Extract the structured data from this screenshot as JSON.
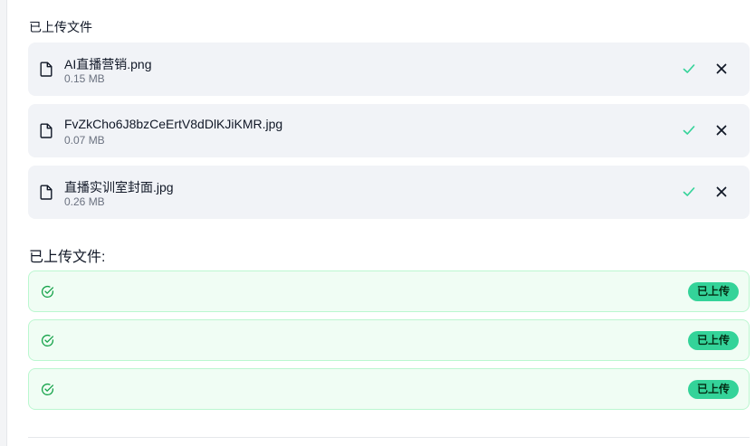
{
  "upload_section": {
    "heading": "已上传文件",
    "files": [
      {
        "name": "AI直播营销.png",
        "size": "0.15 MB"
      },
      {
        "name": "FvZkCho6J8bzCeErtV8dDlKJiKMR.jpg",
        "size": "0.07 MB"
      },
      {
        "name": "直播实训室封面.jpg",
        "size": "0.26 MB"
      }
    ]
  },
  "uploaded_section": {
    "heading": "已上传文件:",
    "rows": [
      {
        "badge": "已上传"
      },
      {
        "badge": "已上传"
      },
      {
        "badge": "已上传"
      }
    ]
  },
  "colors": {
    "card_bg": "#f1f3f7",
    "success_green": "#34d399",
    "success_row_bg": "#f0fdf4",
    "success_border": "#bbf7d0",
    "check_color": "#34d399"
  },
  "icons": {
    "file": "file-icon",
    "check": "check-icon",
    "remove": "close-icon",
    "uploaded": "circle-check-icon"
  }
}
